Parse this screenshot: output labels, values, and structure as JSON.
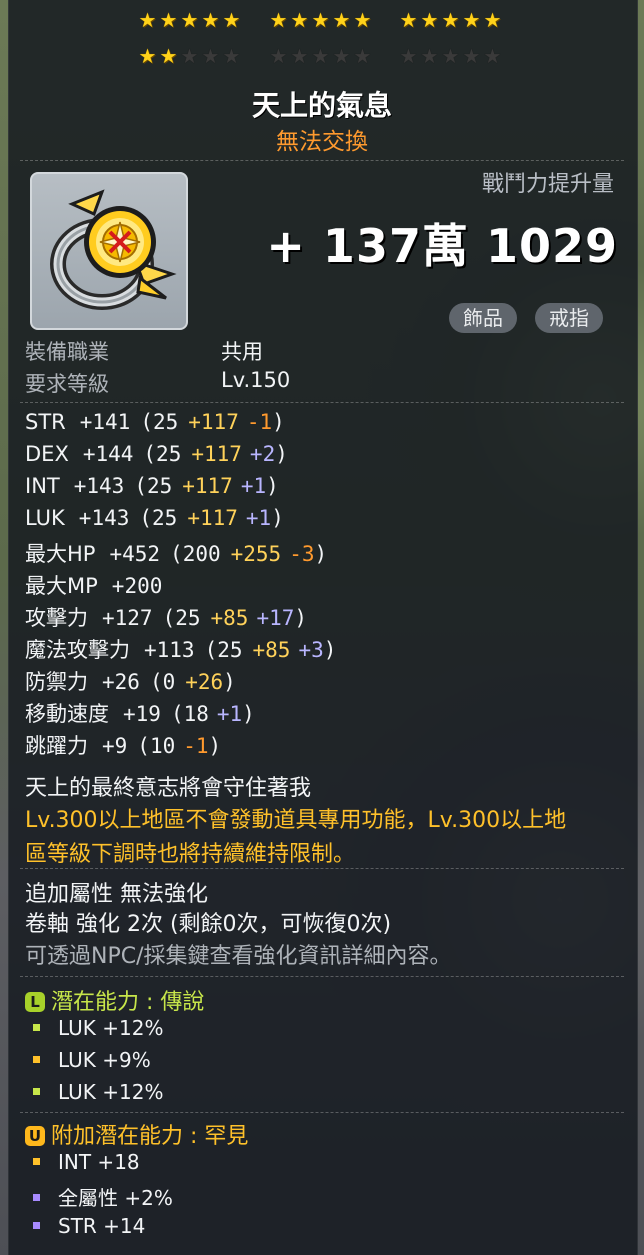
{
  "stars": {
    "filled": 17,
    "total": 30
  },
  "item": {
    "name": "天上的氣息",
    "trade_status": "無法交換",
    "icon": "ring-icon"
  },
  "combat_power": {
    "label": "戰鬥力提升量",
    "value": "+ 137萬 1029"
  },
  "tags": [
    "飾品",
    "戒指"
  ],
  "requirements": [
    {
      "label": "裝備職業",
      "value": "共用"
    },
    {
      "label": "要求等級",
      "value": "Lv.150"
    }
  ],
  "stats": [
    {
      "name": "STR",
      "total": "+141",
      "base": "(25",
      "bonus": "+117",
      "mod": "-1",
      "mod_color": "orange",
      "close": ")"
    },
    {
      "name": "DEX",
      "total": "+144",
      "base": "(25",
      "bonus": "+117",
      "mod": "+2",
      "mod_color": "purple",
      "close": ")"
    },
    {
      "name": "INT",
      "total": "+143",
      "base": "(25",
      "bonus": "+117",
      "mod": "+1",
      "mod_color": "purple",
      "close": ")"
    },
    {
      "name": "LUK",
      "total": "+143",
      "base": "(25",
      "bonus": "+117",
      "mod": "+1",
      "mod_color": "purple",
      "close": ")"
    },
    {
      "name": "最大HP",
      "total": "+452",
      "base": "(200",
      "bonus": "+255",
      "mod": "-3",
      "mod_color": "orange",
      "close": ")"
    },
    {
      "name": "最大MP",
      "total": "+200",
      "base": "",
      "bonus": "",
      "mod": "",
      "mod_color": "",
      "close": ""
    },
    {
      "name": "攻擊力",
      "total": "+127",
      "base": "(25",
      "bonus": "+85",
      "mod": "+17",
      "mod_color": "purple",
      "close": ")"
    },
    {
      "name": "魔法攻擊力",
      "total": "+113",
      "base": "(25",
      "bonus": "+85",
      "mod": "+3",
      "mod_color": "purple",
      "close": ")"
    },
    {
      "name": "防禦力",
      "total": "+26",
      "base": "(0",
      "bonus": "+26",
      "mod": "",
      "mod_color": "",
      "close": ")"
    },
    {
      "name": "移動速度",
      "total": "+19",
      "base": "(18",
      "bonus": "",
      "mod": "+1",
      "mod_color": "purple",
      "close": ")"
    },
    {
      "name": "跳躍力",
      "total": "+9",
      "base": "(10",
      "bonus": "",
      "mod": "-1",
      "mod_color": "orange",
      "close": ")"
    }
  ],
  "description": {
    "flavor": "天上的最終意志將會守住著我",
    "warning_line1": "Lv.300以上地區不會發動道具專用功能，Lv.300以上地",
    "warning_line2": "區等級下調時也將持續維持限制。"
  },
  "enhance": {
    "extra": "追加屬性 無法強化",
    "scroll": "卷軸 強化 2次 (剩餘0次，可恢復0次)",
    "hint": "可透過NPC/採集鍵查看強化資訊詳細內容。"
  },
  "potential": {
    "icon_letter": "L",
    "title": "潛在能力 : 傳說",
    "lines": [
      "LUK +12%",
      "LUK +9%",
      "LUK +12%"
    ],
    "dot_colors": [
      "#c7e64a",
      "#ffc12a",
      "#c7e64a"
    ]
  },
  "additional_potential": {
    "icon_letter": "U",
    "title": "附加潛在能力 : 罕見",
    "lines": [
      "INT +18",
      "全屬性 +2%",
      "STR +14"
    ],
    "dot_colors": [
      "#ffc12a",
      "#a88bff",
      "#a88bff"
    ]
  }
}
